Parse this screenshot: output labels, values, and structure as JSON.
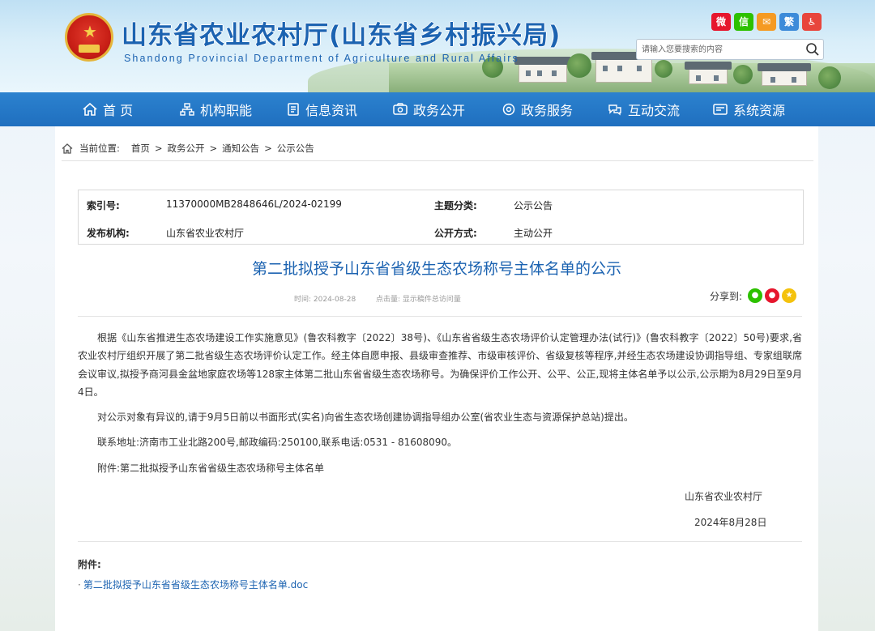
{
  "header": {
    "title": "山东省农业农村厅(山东省乡村振兴局)",
    "subtitle": "Shandong Provincial Department of Agriculture and Rural Affairs",
    "social_icons": [
      {
        "icon": "weibo-icon",
        "glyph": "微",
        "color": "#e6162d"
      },
      {
        "icon": "wechat-icon",
        "glyph": "信",
        "color": "#2dc100"
      },
      {
        "icon": "mail-icon",
        "glyph": "✉",
        "color": "#f59a23"
      },
      {
        "icon": "traditional-chinese-icon",
        "glyph": "繁",
        "color": "#3d8bd9"
      },
      {
        "icon": "accessibility-icon",
        "glyph": "♿",
        "color": "#e8453c"
      }
    ],
    "search_placeholder": "请输入您要搜索的内容"
  },
  "nav": {
    "items": [
      {
        "label": "首 页",
        "icon": "home-icon"
      },
      {
        "label": "机构职能",
        "icon": "org-structure-icon"
      },
      {
        "label": "信息资讯",
        "icon": "news-icon"
      },
      {
        "label": "政务公开",
        "icon": "disclosure-icon"
      },
      {
        "label": "政务服务",
        "icon": "service-icon"
      },
      {
        "label": "互动交流",
        "icon": "interaction-icon"
      },
      {
        "label": "系统资源",
        "icon": "resources-icon"
      }
    ]
  },
  "breadcrumb": {
    "prefix": "当前位置:",
    "items": [
      "首页",
      "政务公开",
      "通知公告",
      "公示公告"
    ],
    "separator": ">"
  },
  "meta": {
    "index_label": "索引号:",
    "index_value": "11370000MB2848646L/2024-02199",
    "topic_label": "主题分类:",
    "topic_value": "公示公告",
    "issuer_label": "发布机构:",
    "issuer_value": "山东省农业农村厅",
    "publish_label": "公开方式:",
    "publish_value": "主动公开"
  },
  "article": {
    "title": "第二批拟授予山东省省级生态农场称号主体名单的公示",
    "time_text": "时间:  2024-08-28",
    "hits_text": "点击量:    显示稿件总访问量",
    "share_label": "分享到:",
    "paragraphs": [
      "根据《山东省推进生态农场建设工作实施意见》(鲁农科教字〔2022〕38号)、《山东省省级生态农场评价认定管理办法(试行)》(鲁农科教字〔2022〕50号)要求,省农业农村厅组织开展了第二批省级生态农场评价认定工作。经主体自愿申报、县级审查推荐、市级审核评价、省级复核等程序,并经生态农场建设协调指导组、专家组联席会议审议,拟授予商河县金盆地家庭农场等128家主体第二批山东省省级生态农场称号。为确保评价工作公开、公平、公正,现将主体名单予以公示,公示期为8月29日至9月4日。",
      "对公示对象有异议的,请于9月5日前以书面形式(实名)向省生态农场创建协调指导组办公室(省农业生态与资源保护总站)提出。",
      "联系地址:济南市工业北路200号,邮政编码:250100,联系电话:0531 - 81608090。",
      "附件:第二批拟授予山东省省级生态农场称号主体名单"
    ],
    "signature": "山东省农业农村厅",
    "date": "2024年8月28日"
  },
  "attachments": {
    "heading": "附件:",
    "items": [
      "第二批拟授予山东省省级生态农场称号主体名单.doc"
    ]
  },
  "share_icons": [
    {
      "icon": "wechat-share-icon",
      "color": "#2dc100"
    },
    {
      "icon": "weibo-share-icon",
      "color": "#e6162d"
    },
    {
      "icon": "qzone-share-icon",
      "color": "#f4c20d"
    }
  ]
}
